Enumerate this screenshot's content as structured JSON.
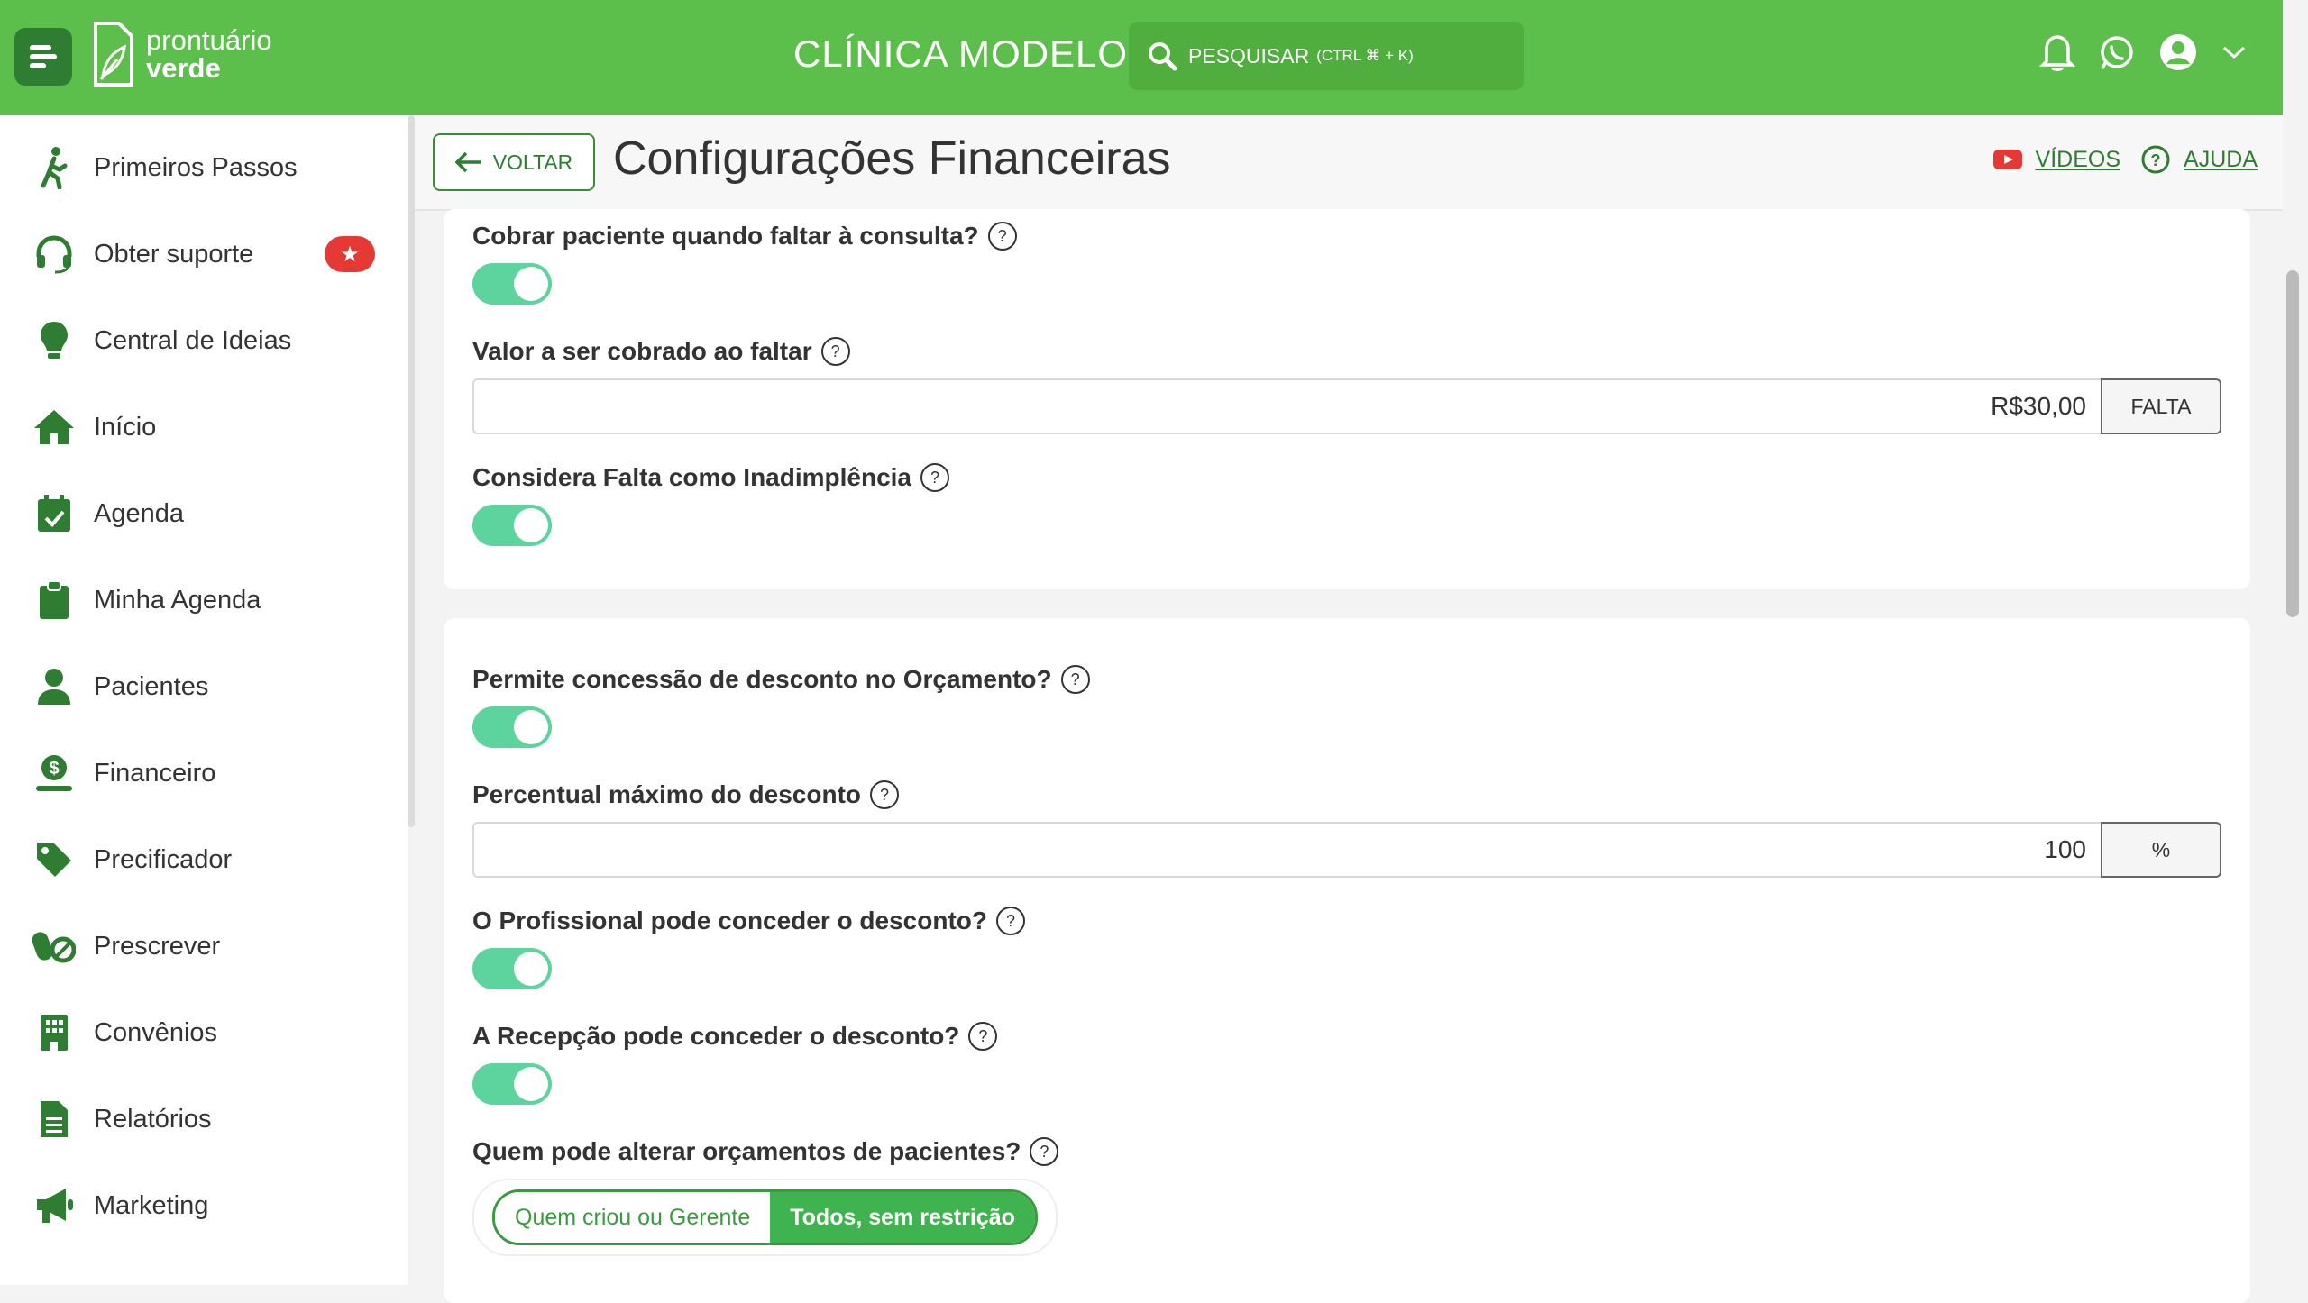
{
  "header": {
    "logo_line1": "prontuário",
    "logo_line2": "verde",
    "clinic_name": "CLÍNICA MODELO",
    "search_label": "PESQUISAR",
    "search_hint": "(CTRL ⌘ + K)"
  },
  "sidebar": {
    "items": [
      {
        "label": "Primeiros Passos",
        "icon": "walking-person-icon"
      },
      {
        "label": "Obter suporte",
        "icon": "headset-icon",
        "badge": "★"
      },
      {
        "label": "Central de Ideias",
        "icon": "lightbulb-icon"
      },
      {
        "label": "Início",
        "icon": "home-icon"
      },
      {
        "label": "Agenda",
        "icon": "calendar-icon"
      },
      {
        "label": "Minha Agenda",
        "icon": "clipboard-icon"
      },
      {
        "label": "Pacientes",
        "icon": "user-icon"
      },
      {
        "label": "Financeiro",
        "icon": "money-hand-icon"
      },
      {
        "label": "Precificador",
        "icon": "tag-icon"
      },
      {
        "label": "Prescrever",
        "icon": "pills-icon"
      },
      {
        "label": "Convênios",
        "icon": "building-icon"
      },
      {
        "label": "Relatórios",
        "icon": "document-icon"
      },
      {
        "label": "Marketing",
        "icon": "megaphone-icon"
      }
    ]
  },
  "topbar": {
    "back_label": "VOLTAR",
    "title": "Configurações Financeiras",
    "videos_label": "VÍDEOS",
    "help_label": "AJUDA"
  },
  "card1": {
    "charge_absent_label": "Cobrar paciente quando faltar à consulta?",
    "charge_value_label": "Valor a ser cobrado ao faltar",
    "charge_value": "R$30,00",
    "charge_addon": "FALTA",
    "default_label": "Considera Falta como Inadimplência"
  },
  "card2": {
    "discount_label": "Permite concessão de desconto no Orçamento?",
    "max_discount_label": "Percentual máximo do desconto",
    "max_discount_value": "100",
    "max_discount_addon": "%",
    "professional_label": "O Profissional pode conceder o desconto?",
    "reception_label": "A Recepção pode conceder o desconto?",
    "who_alter_label": "Quem pode alterar orçamentos de pacientes?",
    "options": [
      "Quem criou ou Gerente",
      "Todos, sem restrição"
    ],
    "selected_option": "Todos, sem restrição"
  },
  "colors": {
    "header_green": "#5dbf4b",
    "dark_green": "#2e7d32",
    "toggle_on": "#5dd39e",
    "badge_red": "#e53935"
  }
}
